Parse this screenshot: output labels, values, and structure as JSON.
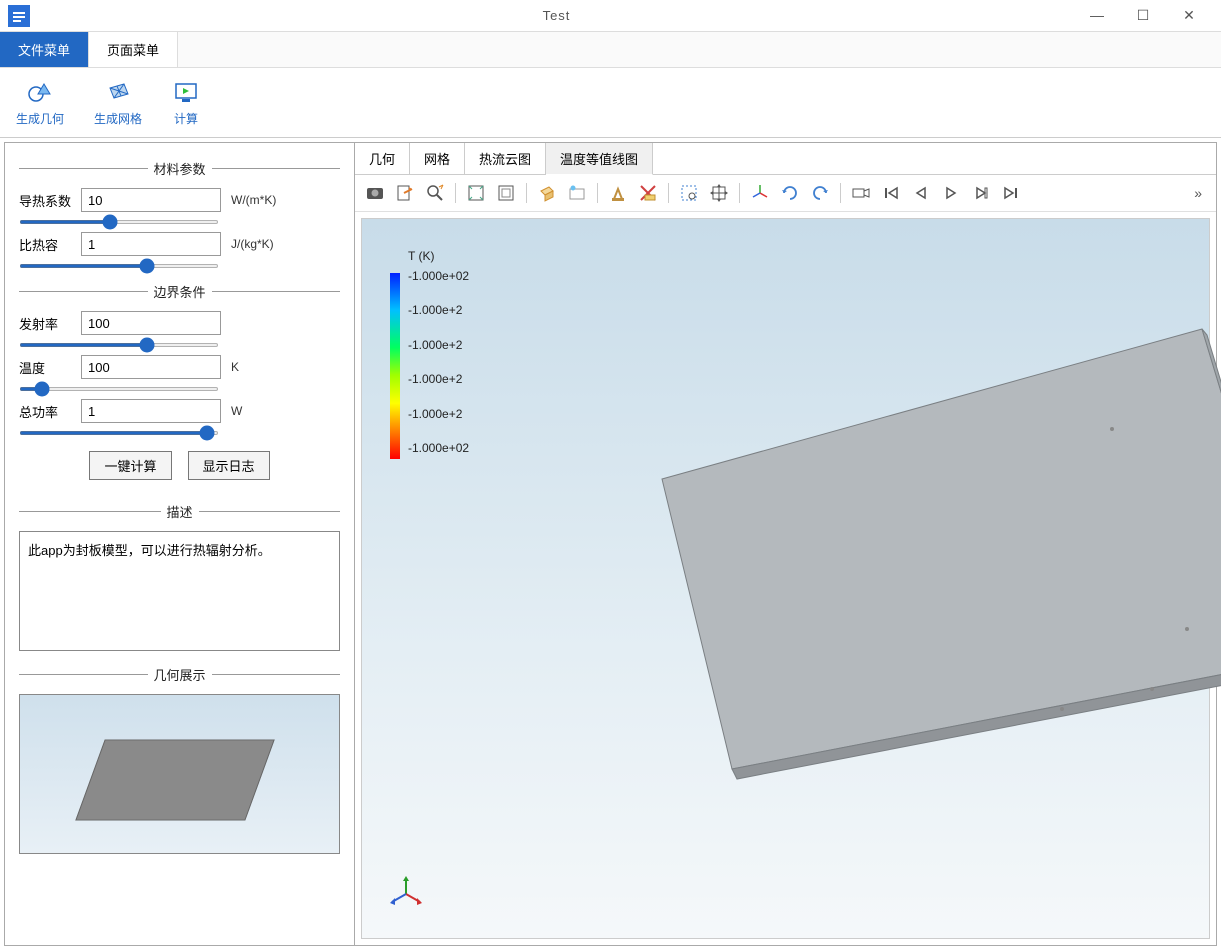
{
  "window": {
    "title": "Test"
  },
  "tabs": {
    "file": "文件菜单",
    "page": "页面菜单"
  },
  "toolbar": {
    "geom": "生成几何",
    "mesh": "生成网格",
    "compute": "计算"
  },
  "sections": {
    "material": "材料参数",
    "boundary": "边界条件",
    "desc": "描述",
    "geom": "几何展示"
  },
  "params": {
    "thermal": {
      "label": "导热系数",
      "value": "10",
      "unit": "W/(m*K)"
    },
    "specific": {
      "label": "比热容",
      "value": "1",
      "unit": "J/(kg*K)"
    },
    "emissivity": {
      "label": "发射率",
      "value": "100",
      "unit": ""
    },
    "temperature": {
      "label": "温度",
      "value": "100",
      "unit": "K"
    },
    "power": {
      "label": "总功率",
      "value": "1",
      "unit": "W"
    }
  },
  "buttons": {
    "compute": "一键计算",
    "log": "显示日志"
  },
  "description": "此app为封板模型，可以进行热辐射分析。",
  "viewtabs": {
    "geom": "几何",
    "mesh": "网格",
    "contour": "热流云图",
    "isotherm": "温度等值线图"
  },
  "legend": {
    "title": "T (K)",
    "ticks": [
      "-1.000e+02",
      "-1.000e+2",
      "-1.000e+2",
      "-1.000e+2",
      "-1.000e+2",
      "-1.000e+02"
    ]
  }
}
